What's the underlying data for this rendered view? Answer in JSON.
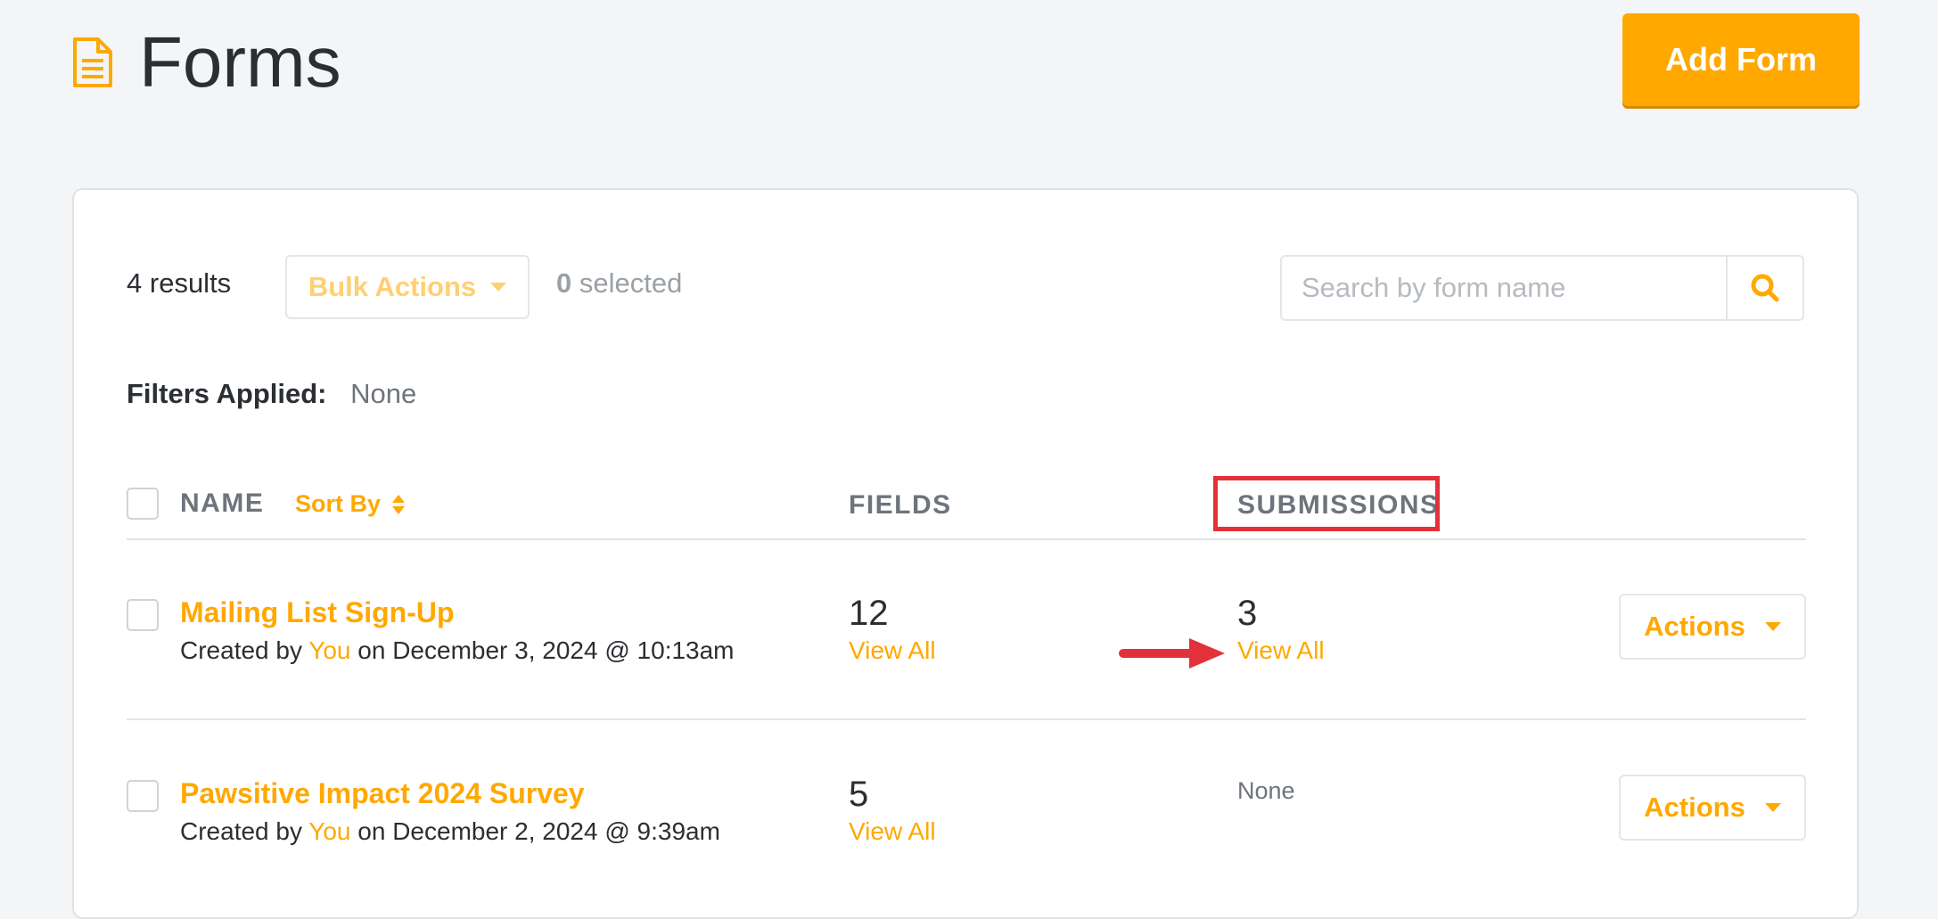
{
  "header": {
    "title": "Forms",
    "add_form_label": "Add Form"
  },
  "toolbar": {
    "results_count": "4",
    "results_label": "results",
    "bulk_actions_label": "Bulk Actions",
    "selected_count": "0",
    "selected_label": "selected",
    "search_placeholder": "Search by form name"
  },
  "filters": {
    "label": "Filters Applied:",
    "value": "None"
  },
  "table": {
    "columns": {
      "name": "NAME",
      "sort_by": "Sort By",
      "fields": "FIELDS",
      "submissions": "SUBMISSIONS"
    },
    "rows": [
      {
        "name": "Mailing List Sign-Up",
        "created_prefix": "Created by",
        "created_by": "You",
        "created_on": "on December 3, 2024 @ 10:13am",
        "fields_count": "12",
        "fields_link": "View All",
        "submissions_count": "3",
        "submissions_link": "View All",
        "actions_label": "Actions"
      },
      {
        "name": "Pawsitive Impact 2024 Survey",
        "created_prefix": "Created by",
        "created_by": "You",
        "created_on": "on December 2, 2024 @ 9:39am",
        "fields_count": "5",
        "fields_link": "View All",
        "submissions_none": "None",
        "actions_label": "Actions"
      }
    ]
  },
  "colors": {
    "accent": "#ffa800",
    "annotation": "#e2313a"
  },
  "icons": {
    "page": "document-icon",
    "search": "search-icon",
    "sort": "sort-icon",
    "caret": "caret-down-icon",
    "annotation_arrow": "arrow-right-icon"
  }
}
